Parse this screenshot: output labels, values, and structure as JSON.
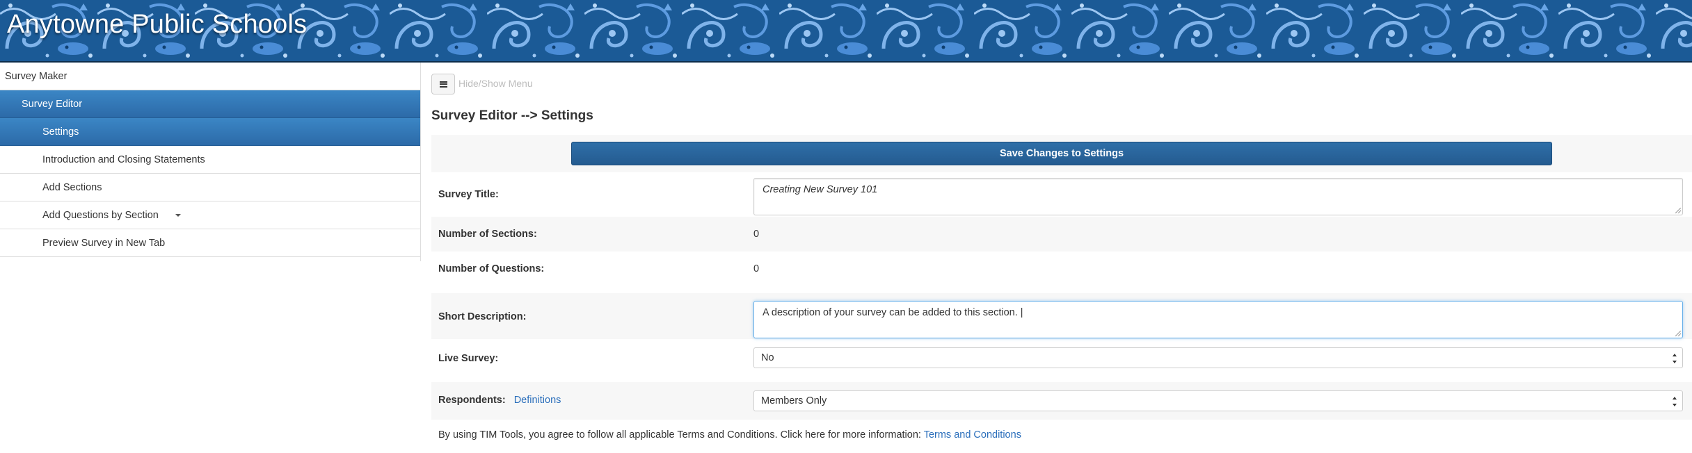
{
  "header": {
    "title": "Anytowne Public Schools"
  },
  "sidebar": {
    "items": [
      {
        "label": "Survey Maker"
      },
      {
        "label": "Survey Editor"
      },
      {
        "label": "Settings"
      },
      {
        "label": "Introduction and Closing Statements"
      },
      {
        "label": "Add Sections"
      },
      {
        "label": "Add Questions by Section"
      },
      {
        "label": "Preview Survey in New Tab"
      }
    ]
  },
  "main": {
    "menu_toggle_label": "Hide/Show Menu",
    "page_title": "Survey Editor --> Settings",
    "save_button_label": "Save Changes to Settings",
    "fields": {
      "survey_title": {
        "label": "Survey Title:",
        "value": "Creating New Survey 101"
      },
      "num_sections": {
        "label": "Number of Sections:",
        "value": "0"
      },
      "num_questions": {
        "label": "Number of Questions:",
        "value": "0"
      },
      "short_description": {
        "label": "Short Description:",
        "value": "A description of your survey can be added to this section. |"
      },
      "live_survey": {
        "label": "Live Survey:",
        "value": "No"
      },
      "respondents": {
        "label": "Respondents:",
        "link": "Definitions",
        "value": "Members Only"
      }
    },
    "terms": {
      "text": "By using TIM Tools, you agree to follow all applicable Terms and Conditions. Click here for more information:",
      "link": "Terms and Conditions"
    }
  },
  "colors": {
    "banner_blue": "#1b5a96",
    "active_nav": "#2c6aa8",
    "button_blue": "#245b90",
    "link_blue": "#2a6ebb"
  }
}
